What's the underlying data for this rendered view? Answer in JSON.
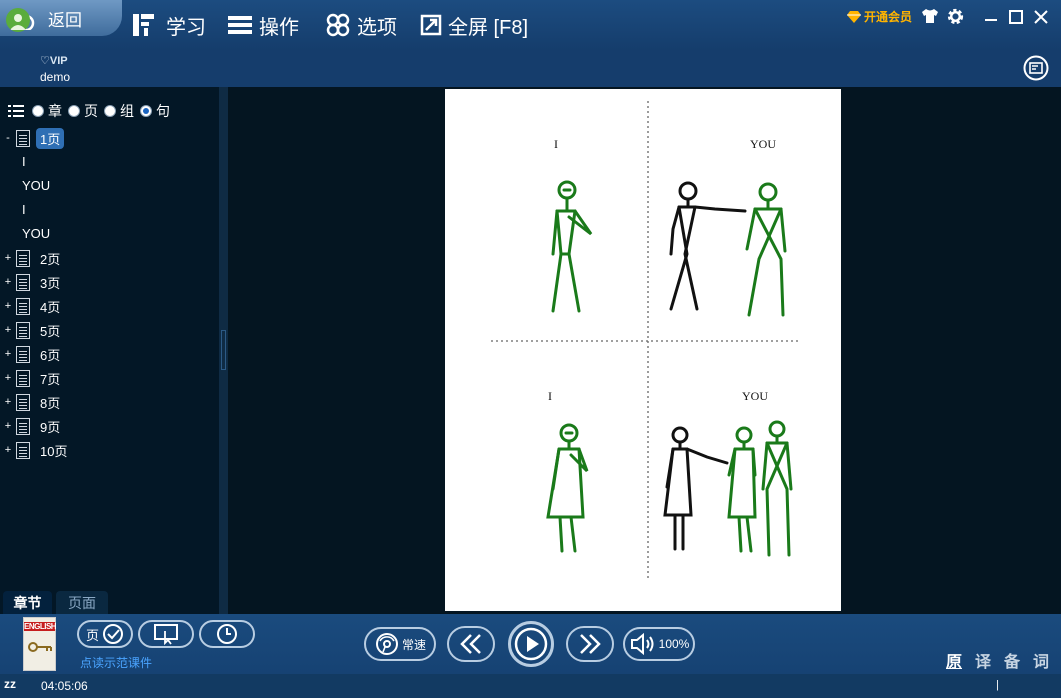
{
  "toolbar": {
    "back": "返回",
    "learn": "学习",
    "operate": "操作",
    "options": "选项",
    "fullscreen": "全屏 [F8]",
    "open_vip": "开通会员"
  },
  "user": {
    "vip": "VIP",
    "name": "demo"
  },
  "sidebar": {
    "modes": [
      {
        "label": "章",
        "selected": false
      },
      {
        "label": "页",
        "selected": false
      },
      {
        "label": "组",
        "selected": false
      },
      {
        "label": "句",
        "selected": true
      }
    ],
    "pages": [
      "1页",
      "2页",
      "3页",
      "4页",
      "5页",
      "6页",
      "7页",
      "8页",
      "9页",
      "10页"
    ],
    "sentences": [
      "I",
      "YOU",
      "I",
      "YOU"
    ],
    "expanded_marker": "-",
    "collapsed_marker": "+",
    "tab_chapter": "章节",
    "tab_page": "页面"
  },
  "page_content": {
    "labels": [
      "I",
      "YOU",
      "I",
      "YOU"
    ]
  },
  "bottom": {
    "page_check": "页",
    "demo_link": "点读示范课件",
    "speed": "常速",
    "volume": "100%",
    "trans": [
      "原",
      "译",
      "备",
      "词"
    ],
    "sleep": "zz",
    "time": "04:05:06",
    "book_cover": "ENGLISH"
  },
  "colors": {
    "accent": "#2f6fb4",
    "vip": "#ffb400",
    "figure_green": "#1a7a1a"
  }
}
